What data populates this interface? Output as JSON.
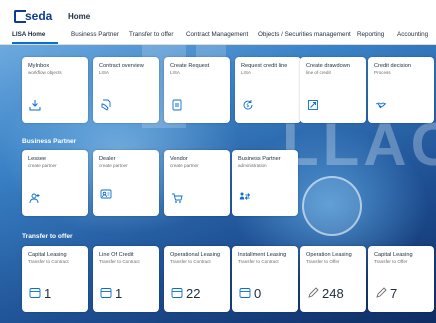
{
  "header": {
    "logo_text": "seda",
    "page_title": "Home"
  },
  "tabs": [
    {
      "label": "LISA Home",
      "active": true
    },
    {
      "label": "Business Partner",
      "active": false
    },
    {
      "label": "Transfer to offer",
      "active": false
    },
    {
      "label": "Contract Management",
      "active": false
    },
    {
      "label": "Objects / Securities management",
      "active": false
    },
    {
      "label": "Reporting",
      "active": false
    },
    {
      "label": "Accounting",
      "active": false
    }
  ],
  "sections": {
    "lisa": {
      "tiles": [
        {
          "title": "MyInbox",
          "subtitle": "workflow objects",
          "icon": "inbox-download-icon"
        },
        {
          "title": "Contract overview",
          "subtitle": "LISA",
          "icon": "contract-hand-icon"
        },
        {
          "title": "Create Request",
          "subtitle": "LISA",
          "icon": "document-icon"
        },
        {
          "title": "Request credit line",
          "subtitle": "LISA",
          "icon": "money-cycle-icon"
        },
        {
          "title": "Create drawdown",
          "subtitle": "line of credit",
          "icon": "chart-box-icon"
        },
        {
          "title": "Credit decision",
          "subtitle": "Process",
          "icon": "handshake-icon"
        }
      ]
    },
    "business_partner": {
      "title": "Business Partner",
      "tiles": [
        {
          "title": "Lessee",
          "subtitle": "create partner",
          "icon": "add-user-icon"
        },
        {
          "title": "Dealer",
          "subtitle": "create partner",
          "icon": "user-card-icon"
        },
        {
          "title": "Vendor",
          "subtitle": "create partner",
          "icon": "cart-icon"
        },
        {
          "title": "Business Partner",
          "subtitle": "administration",
          "icon": "partner-transfer-icon"
        }
      ]
    },
    "transfer_to_offer": {
      "title": "Transfer to offer",
      "tiles": [
        {
          "title": "Capital Leasing",
          "subtitle": "Transfer to Contract",
          "count": "1",
          "icon": "folder-icon"
        },
        {
          "title": "Line Of Credit",
          "subtitle": "Transfer to Contract",
          "count": "1",
          "icon": "folder-icon"
        },
        {
          "title": "Operational Leasing",
          "subtitle": "Transfer to Contract",
          "count": "22",
          "icon": "folder-icon"
        },
        {
          "title": "Installment Leasing",
          "subtitle": "Transfer to Contract",
          "count": "0",
          "icon": "folder-icon"
        },
        {
          "title": "Operation Leasing",
          "subtitle": "Transfer to Offer",
          "count": "248",
          "icon": "pencil-icon"
        },
        {
          "title": "Capital Leasing",
          "subtitle": "Transfer to Offer",
          "count": "7",
          "icon": "pencil-icon"
        }
      ]
    }
  },
  "colors": {
    "brand": "#0b3d91",
    "accent": "#0a6ed1",
    "icon": "#0a6ed1",
    "text": "#1d2d3e"
  }
}
